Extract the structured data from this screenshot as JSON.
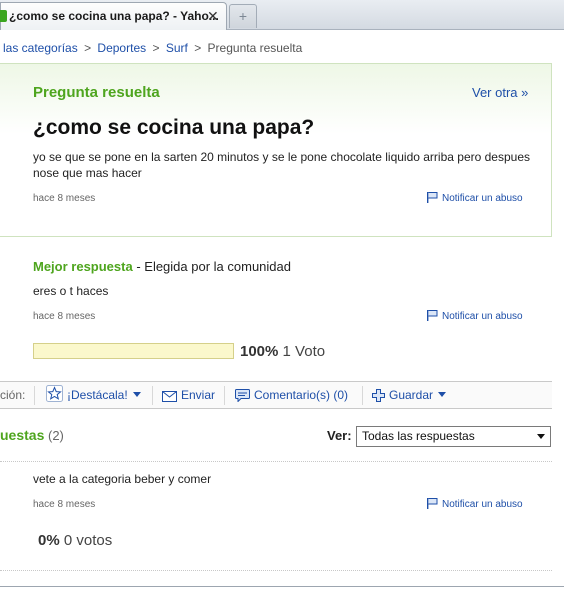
{
  "browser": {
    "tab_title": "¿como se cocina una papa? - Yaho...",
    "tab_close": "✕",
    "new_tab": "+"
  },
  "breadcrumb": {
    "items": [
      "las categorías",
      "Deportes",
      "Surf"
    ],
    "current": "Pregunta resuelta",
    "separator": ">"
  },
  "question": {
    "status_label": "Pregunta resuelta",
    "ver_otra": "Ver otra »",
    "title": "¿como se cocina una papa?",
    "body": "yo se que se pone en la sarten 20 minutos y se le pone chocolate liquido arriba pero despues nose que mas hacer",
    "time": "hace 8 meses",
    "report": "Notificar un abuso"
  },
  "best_answer": {
    "label": "Mejor respuesta",
    "chosen_by": "- Elegida por la comunidad",
    "body": "eres o t haces",
    "time": "hace 8 meses",
    "report": "Notificar un abuso",
    "vote_percent": "100%",
    "vote_count": "1 Voto",
    "vote_fraction": 1.0
  },
  "actions": {
    "cut_label": "ción:",
    "destacala": "¡Destácala!",
    "enviar": "Enviar",
    "comentarios": "Comentario(s) (0)",
    "guardar": "Guardar"
  },
  "answers": {
    "title": "uestas",
    "count": "(2)",
    "ver_label": "Ver:",
    "filter_selected": "Todas las respuestas",
    "items": [
      {
        "body": "vete a la categoria beber y comer",
        "time": "hace 8 meses",
        "report": "Notificar un abuso",
        "vote_percent": "0%",
        "vote_count": "0 votos"
      }
    ]
  },
  "colors": {
    "green": "#4ea51e",
    "link": "#1e4fa8"
  }
}
